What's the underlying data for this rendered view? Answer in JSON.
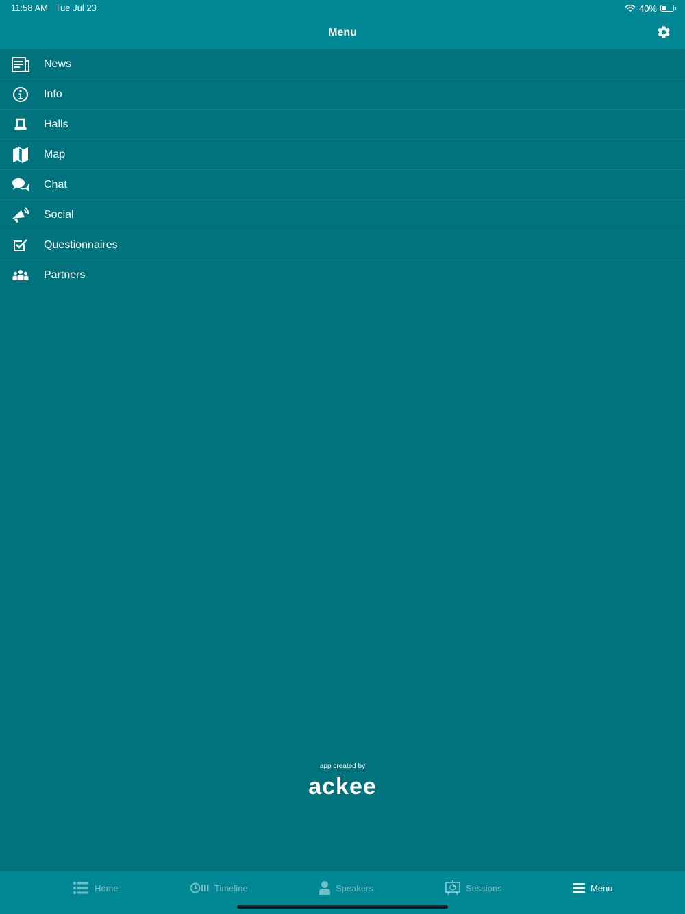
{
  "status_bar": {
    "time": "11:58 AM",
    "date": "Tue Jul 23",
    "battery": "40%",
    "battery_level": 0.4
  },
  "nav": {
    "title": "Menu",
    "settings_icon": "gear-icon"
  },
  "menu": {
    "items": [
      {
        "label": "News",
        "icon": "newspaper-icon"
      },
      {
        "label": "Info",
        "icon": "info-icon"
      },
      {
        "label": "Halls",
        "icon": "hall-icon"
      },
      {
        "label": "Map",
        "icon": "map-icon"
      },
      {
        "label": "Chat",
        "icon": "chat-icon"
      },
      {
        "label": "Social",
        "icon": "megaphone-icon"
      },
      {
        "label": "Questionnaires",
        "icon": "checkbox-icon"
      },
      {
        "label": "Partners",
        "icon": "group-icon"
      }
    ]
  },
  "credit": {
    "caption": "app created by",
    "logo": "ackee"
  },
  "tabbar": {
    "tabs": [
      {
        "label": "Home",
        "icon": "list-icon",
        "active": false
      },
      {
        "label": "Timeline",
        "icon": "timeline-icon",
        "active": false
      },
      {
        "label": "Speakers",
        "icon": "person-icon",
        "active": false
      },
      {
        "label": "Sessions",
        "icon": "presentation-icon",
        "active": false
      },
      {
        "label": "Menu",
        "icon": "hamburger-icon",
        "active": true
      }
    ]
  },
  "colors": {
    "background": "#00737d",
    "bar": "#008894",
    "text": "#ffffff"
  }
}
